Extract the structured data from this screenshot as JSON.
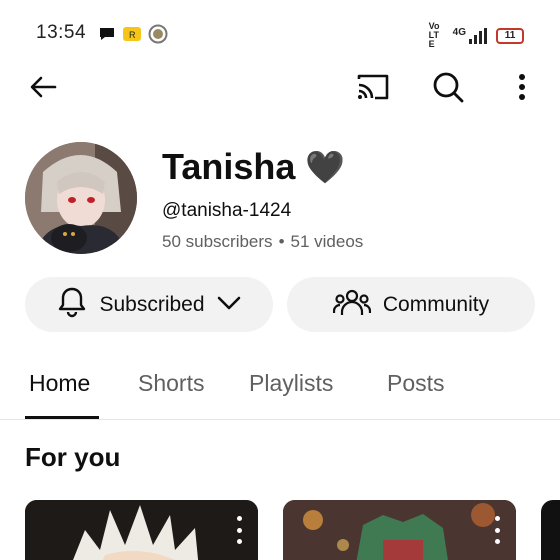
{
  "status_bar": {
    "time": "13:54",
    "network_label": "4G",
    "volte_label": "Vo LTE",
    "battery_level": "11",
    "left_icons": [
      "chat-bubble-icon",
      "tag-icon",
      "circle-r-icon"
    ],
    "right_icons": [
      "volte-icon",
      "signal-icon",
      "battery-icon"
    ]
  },
  "topbar": {
    "icons": [
      "back-arrow-icon",
      "cast-icon",
      "search-icon",
      "more-vert-icon"
    ]
  },
  "channel": {
    "name": "Tanisha",
    "emoji": "🖤",
    "handle": "@tanisha-1424",
    "subscribers": "50 subscribers",
    "separator": "•",
    "videos": "51 videos"
  },
  "actions": {
    "subscribed_label": "Subscribed",
    "community_label": "Community"
  },
  "tabs": [
    "Home",
    "Shorts",
    "Playlists",
    "Posts"
  ],
  "active_tab": "Home",
  "section": {
    "title": "For you"
  },
  "colors": {
    "text_primary": "#0f0f0f",
    "text_secondary": "#606060",
    "pill_bg": "#f2f2f2",
    "divider": "#e5e5e5"
  }
}
